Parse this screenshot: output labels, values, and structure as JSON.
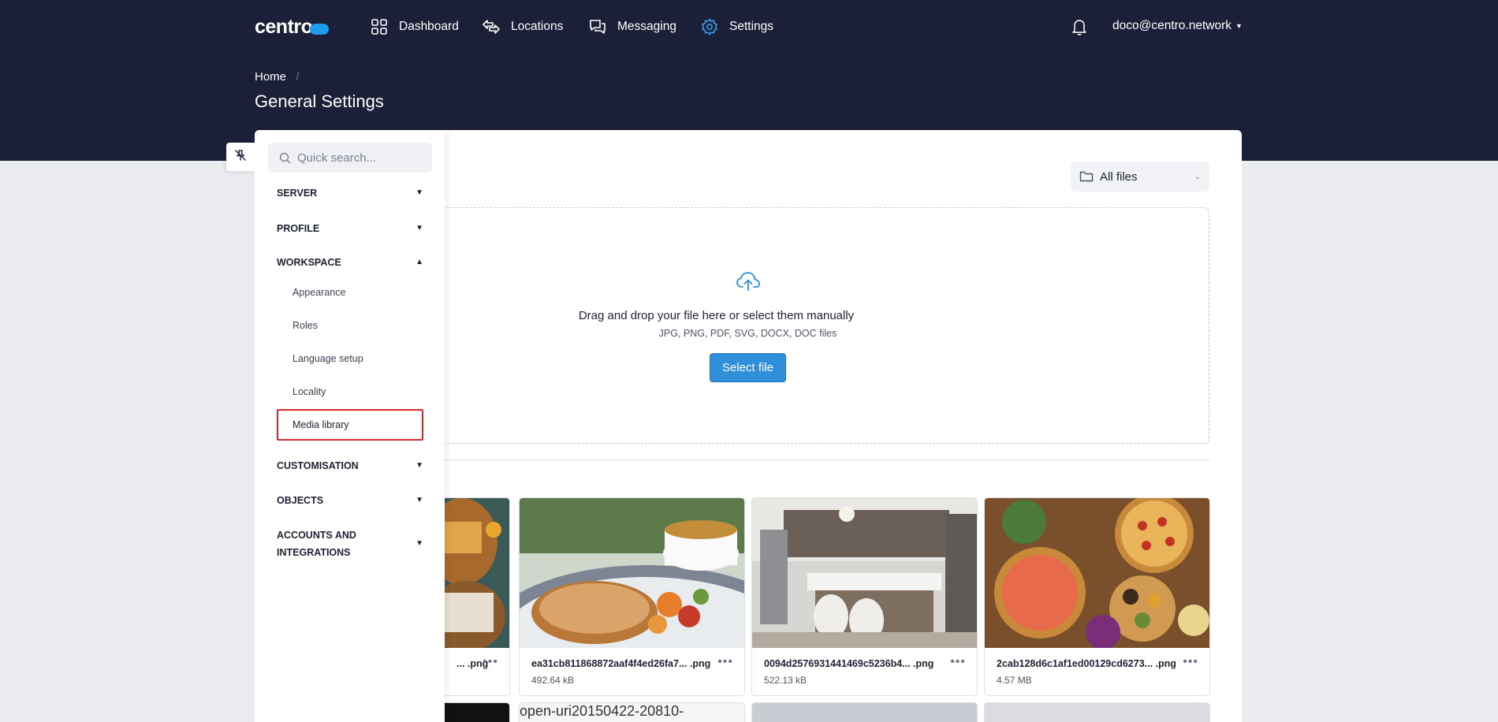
{
  "header": {
    "logo_text": "centro",
    "nav": [
      {
        "label": "Dashboard",
        "icon": "grid-icon"
      },
      {
        "label": "Locations",
        "icon": "arrows-icon"
      },
      {
        "label": "Messaging",
        "icon": "chat-bubbles-icon"
      },
      {
        "label": "Settings",
        "icon": "gear-icon",
        "active": true
      }
    ],
    "user_email": "doco@centro.network",
    "breadcrumb": "Home",
    "breadcrumb_sep": "/",
    "page_title": "General Settings",
    "accent_color": "#3aa0ea",
    "bg_color": "#1b2038"
  },
  "sidebar": {
    "search_placeholder": "Quick search...",
    "sections": [
      {
        "label": "SERVER",
        "expanded": false
      },
      {
        "label": "PROFILE",
        "expanded": false
      },
      {
        "label": "WORKSPACE",
        "expanded": true
      },
      {
        "label": "CUSTOMISATION",
        "expanded": false
      },
      {
        "label": "OBJECTS",
        "expanded": false
      },
      {
        "label": "ACCOUNTS AND",
        "label2": "INTEGRATIONS",
        "expanded": false
      }
    ],
    "workspace_items": [
      "Appearance",
      "Roles",
      "Language setup",
      "Locality",
      "Media library"
    ],
    "selected_item": "Media library",
    "highlight_color": "#d9262c"
  },
  "media": {
    "folder_filter": "All files",
    "dropzone_title": "Drag and drop your file here or select them manually",
    "dropzone_formats": "JPG, PNG, PDF, SVG, DOCX, DOC files",
    "select_button": "Select file",
    "files": [
      {
        "name": "... .png",
        "size": ""
      },
      {
        "name": "ea31cb811868872aaf4f4ed26fa7... .png",
        "size": "492.64 kB"
      },
      {
        "name": "0094d2576931441469c5236b4... .png",
        "size": "522.13 kB"
      },
      {
        "name": "2cab128d6c1af1ed00129cd6273... .png",
        "size": "4.57 MB"
      }
    ],
    "broken_image_alt": "open-uri20150422-20810-",
    "more_glyph": "•••"
  }
}
